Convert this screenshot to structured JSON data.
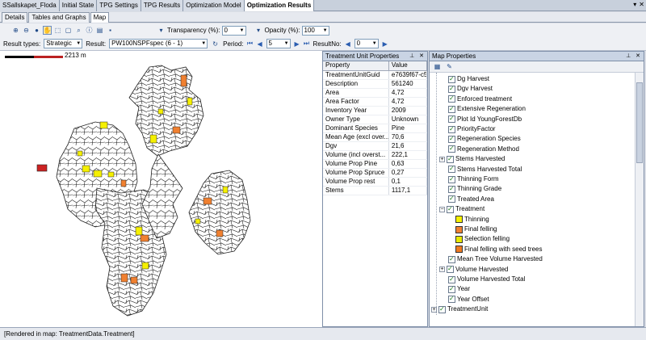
{
  "doc_tabs": [
    "SSallskapet_Floda",
    "Initial State",
    "TPG Settings",
    "TPG Results",
    "Optimization Model",
    "Optimization Results"
  ],
  "doc_tab_active": "Optimization Results",
  "sub_tabs": [
    "Details",
    "Tables and Graphs",
    "Map"
  ],
  "sub_tab_active": "Map",
  "toolbar": {
    "transparency_label": "Transparency (%):",
    "transparency_value": "0",
    "opacity_label": "Opacity (%):",
    "opacity_value": "100",
    "result_types_label": "Result types:",
    "result_types_value": "Strategic",
    "result_label": "Result:",
    "result_value": "PW100NSPFspec (6 - 1)",
    "period_label": "Period:",
    "period_value": "5",
    "resultno_label": "ResultNo:",
    "resultno_value": "0"
  },
  "scale": {
    "label": "2213 m"
  },
  "treatment_unit_properties": {
    "title": "Treatment Unit Properties",
    "columns": [
      "Property",
      "Value"
    ],
    "rows": [
      [
        "TreatmentUnitGuid",
        "e7639f67-c51"
      ],
      [
        "Description",
        "561240"
      ],
      [
        "Area",
        "4,72"
      ],
      [
        "Area Factor",
        "4,72"
      ],
      [
        "Inventory Year",
        "2009"
      ],
      [
        "Owner Type",
        "Unknown"
      ],
      [
        "Dominant Species",
        "Pine"
      ],
      [
        "Mean Age (excl over...",
        "70,6"
      ],
      [
        "Dgv",
        "21,6"
      ],
      [
        "Volume (incl overst...",
        "222,1"
      ],
      [
        "Volume Prop Pine",
        "0,63"
      ],
      [
        "Volume Prop Spruce",
        "0,27"
      ],
      [
        "Volume Prop rest",
        "0,1"
      ],
      [
        "Stems",
        "1117,1"
      ]
    ]
  },
  "map_properties": {
    "title": "Map Properties",
    "items": [
      "Dg Harvest",
      "Dgv Harvest",
      "Enforced treatment",
      "Extensive Regeneration",
      "Plot Id YoungForestDb",
      "PriorityFactor",
      "Regeneration Species",
      "Regeneration Method",
      "Stems Harvested",
      "Stems Harvested Total",
      "Thinning Form",
      "Thinning Grade",
      "Treated Area",
      "Treatment"
    ],
    "treatment_children": [
      {
        "label": "Thinning",
        "color": "#f5f000"
      },
      {
        "label": "Final felling",
        "color": "#f08030"
      },
      {
        "label": "Selection felling",
        "color": "#e8e800"
      },
      {
        "label": "Final felling with seed trees",
        "color": "#ee7a20"
      }
    ],
    "items_after": [
      "Mean Tree Volume Harvested",
      "Volume Harvested",
      "Volume Harvested Total",
      "Year",
      "Year Offset"
    ],
    "root_item": "TreatmentUnit"
  },
  "status_text": "[Rendered in map: TreatmentData.Treatment]",
  "colors": {
    "thinning": "#f5f000",
    "final_felling": "#f08030",
    "stand_outline": "#222222",
    "selected": "#cc2222"
  }
}
